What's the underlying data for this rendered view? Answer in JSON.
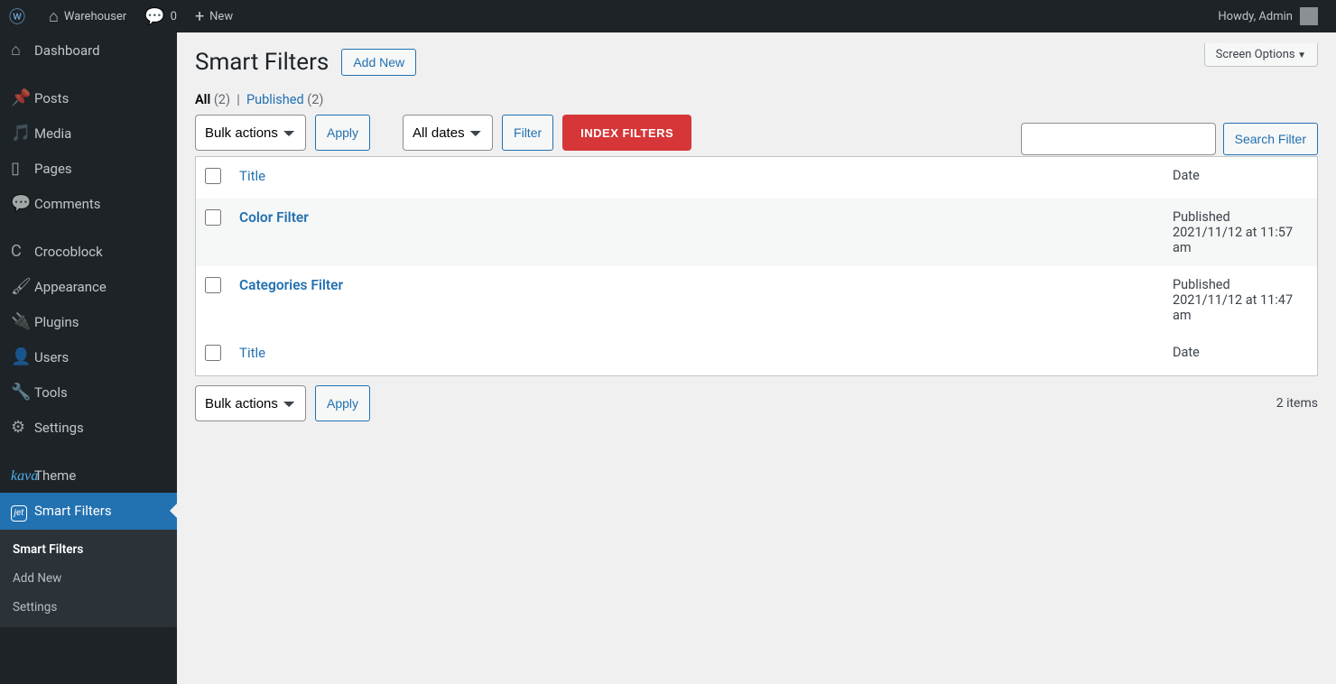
{
  "adminbar": {
    "site_name": "Warehouser",
    "comments_count": "0",
    "new_label": "New",
    "howdy": "Howdy, Admin"
  },
  "sidebar": {
    "items": [
      {
        "icon": "⌂",
        "label": "Dashboard"
      },
      {
        "sep": true
      },
      {
        "icon": "📌",
        "label": "Posts"
      },
      {
        "icon": "🎵",
        "label": "Media"
      },
      {
        "icon": "▯",
        "label": "Pages"
      },
      {
        "icon": "💬",
        "label": "Comments"
      },
      {
        "sep": true
      },
      {
        "icon": "C",
        "label": "Crocoblock"
      },
      {
        "icon": "🖌",
        "label": "Appearance"
      },
      {
        "icon": "🔌",
        "label": "Plugins"
      },
      {
        "icon": "👤",
        "label": "Users"
      },
      {
        "icon": "🔧",
        "label": "Tools"
      },
      {
        "icon": "⚙",
        "label": "Settings"
      },
      {
        "sep": true
      },
      {
        "kava": true,
        "label": "Theme"
      },
      {
        "jet": true,
        "label": "Smart Filters",
        "current": true
      }
    ],
    "submenu": [
      {
        "label": "Smart Filters",
        "active": true
      },
      {
        "label": "Add New"
      },
      {
        "label": "Settings"
      }
    ]
  },
  "screen_options": "Screen Options",
  "page": {
    "title": "Smart Filters",
    "add_new": "Add New"
  },
  "tabs": {
    "all_label": "All",
    "all_count": "(2)",
    "sep": "|",
    "published_label": "Published",
    "published_count": "(2)"
  },
  "search": {
    "button": "Search Filter"
  },
  "bulk": {
    "default": "Bulk actions",
    "apply": "Apply",
    "dates_default": "All dates",
    "filter": "Filter",
    "index": "INDEX FILTERS",
    "items_count": "2 items"
  },
  "columns": {
    "title": "Title",
    "date": "Date"
  },
  "rows": [
    {
      "title": "Color Filter",
      "status": "Published",
      "date": "2021/11/12 at 11:57 am"
    },
    {
      "title": "Categories Filter",
      "status": "Published",
      "date": "2021/11/12 at 11:47 am"
    }
  ]
}
